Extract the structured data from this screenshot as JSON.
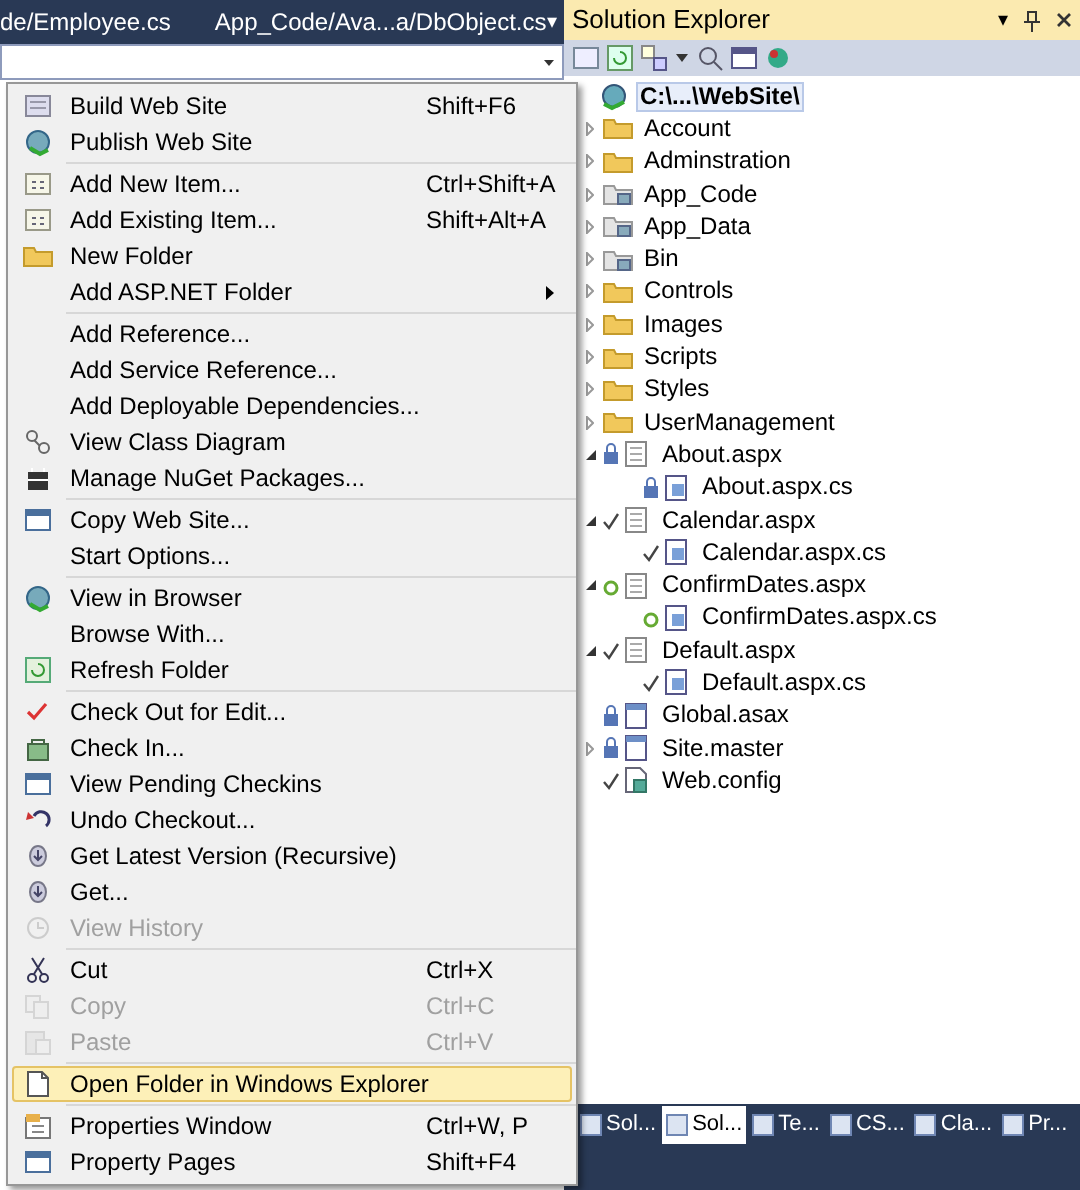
{
  "document_tabs": [
    {
      "label": "de/Employee.cs"
    },
    {
      "label": "App_Code/Ava...a/DbObject.cs"
    }
  ],
  "tabs_menu_button": "▾",
  "context_menu": [
    {
      "label": "Build Web Site",
      "shortcut": "Shift+F6",
      "disabled": false,
      "selected": false
    },
    {
      "label": "Publish Web Site",
      "disabled": false,
      "selected": false,
      "separator_after": true
    },
    {
      "label": "Add New Item...",
      "shortcut": "Ctrl+Shift+A",
      "disabled": false,
      "selected": false
    },
    {
      "label": "Add Existing Item...",
      "shortcut": "Shift+Alt+A",
      "disabled": false,
      "selected": false
    },
    {
      "label": "New Folder",
      "disabled": false,
      "selected": false
    },
    {
      "label": "Add ASP.NET Folder",
      "submenu": true,
      "disabled": false,
      "selected": false,
      "separator_after": true
    },
    {
      "label": "Add Reference...",
      "disabled": false,
      "selected": false
    },
    {
      "label": "Add Service Reference...",
      "disabled": false,
      "selected": false
    },
    {
      "label": "Add Deployable Dependencies...",
      "disabled": false,
      "selected": false
    },
    {
      "label": "View Class Diagram",
      "disabled": false,
      "selected": false
    },
    {
      "label": "Manage NuGet Packages...",
      "disabled": false,
      "selected": false,
      "separator_after": true
    },
    {
      "label": "Copy Web Site...",
      "disabled": false,
      "selected": false
    },
    {
      "label": "Start Options...",
      "disabled": false,
      "selected": false,
      "separator_after": true
    },
    {
      "label": "View in Browser",
      "disabled": false,
      "selected": false
    },
    {
      "label": "Browse With...",
      "disabled": false,
      "selected": false
    },
    {
      "label": "Refresh Folder",
      "disabled": false,
      "selected": false,
      "separator_after": true
    },
    {
      "label": "Check Out for Edit...",
      "disabled": false,
      "selected": false
    },
    {
      "label": "Check In...",
      "disabled": false,
      "selected": false
    },
    {
      "label": "View Pending Checkins",
      "disabled": false,
      "selected": false
    },
    {
      "label": "Undo Checkout...",
      "disabled": false,
      "selected": false
    },
    {
      "label": "Get Latest Version (Recursive)",
      "disabled": false,
      "selected": false
    },
    {
      "label": "Get...",
      "disabled": false,
      "selected": false
    },
    {
      "label": "View History",
      "disabled": true,
      "selected": false,
      "separator_after": true
    },
    {
      "label": "Cut",
      "shortcut": "Ctrl+X",
      "disabled": false,
      "selected": false
    },
    {
      "label": "Copy",
      "shortcut": "Ctrl+C",
      "disabled": true,
      "selected": false
    },
    {
      "label": "Paste",
      "shortcut": "Ctrl+V",
      "disabled": true,
      "selected": false,
      "separator_after": true
    },
    {
      "label": "Open Folder in Windows Explorer",
      "disabled": false,
      "selected": true,
      "separator_after": true
    },
    {
      "label": "Properties Window",
      "shortcut": "Ctrl+W, P",
      "disabled": false,
      "selected": false
    },
    {
      "label": "Property Pages",
      "shortcut": "Shift+F4",
      "disabled": false,
      "selected": false
    }
  ],
  "solution_explorer": {
    "title": "Solution Explorer",
    "window_controls": [
      "▾"
    ],
    "tree": [
      {
        "label": "C:\\...\\WebSite\\",
        "kind": "site",
        "selected": true,
        "children": [
          {
            "label": "Account",
            "kind": "folder",
            "selected": false,
            "expanded": false
          },
          {
            "label": "Adminstration",
            "kind": "folder",
            "selected": false,
            "expanded": false
          },
          {
            "label": "App_Code",
            "kind": "special_folder",
            "selected": false,
            "expanded": false
          },
          {
            "label": "App_Data",
            "kind": "special_folder",
            "selected": false,
            "expanded": false
          },
          {
            "label": "Bin",
            "kind": "special_folder",
            "selected": false,
            "expanded": false
          },
          {
            "label": "Controls",
            "kind": "folder",
            "selected": false,
            "expanded": false
          },
          {
            "label": "Images",
            "kind": "folder",
            "selected": false,
            "expanded": false
          },
          {
            "label": "Scripts",
            "kind": "folder",
            "selected": false,
            "expanded": false
          },
          {
            "label": "Styles",
            "kind": "folder",
            "selected": false,
            "expanded": false
          },
          {
            "label": "UserManagement",
            "kind": "folder",
            "selected": false,
            "expanded": false
          },
          {
            "label": "About.aspx",
            "kind": "page",
            "checked_out": false,
            "pending_add": false,
            "selected": false,
            "expanded": true,
            "children": [
              {
                "label": "About.aspx.cs",
                "kind": "code",
                "checked_out": false,
                "pending_add": false,
                "selected": false
              }
            ]
          },
          {
            "label": "Calendar.aspx",
            "kind": "page",
            "checked_out": true,
            "pending_add": false,
            "selected": false,
            "expanded": true,
            "children": [
              {
                "label": "Calendar.aspx.cs",
                "kind": "code",
                "checked_out": true,
                "pending_add": false,
                "selected": false
              }
            ]
          },
          {
            "label": "ConfirmDates.aspx",
            "kind": "page",
            "checked_out": false,
            "pending_add": true,
            "selected": false,
            "expanded": true,
            "children": [
              {
                "label": "ConfirmDates.aspx.cs",
                "kind": "code",
                "checked_out": false,
                "pending_add": true,
                "selected": false
              }
            ]
          },
          {
            "label": "Default.aspx",
            "kind": "page",
            "checked_out": true,
            "pending_add": false,
            "selected": false,
            "expanded": true,
            "children": [
              {
                "label": "Default.aspx.cs",
                "kind": "code",
                "checked_out": true,
                "pending_add": false,
                "selected": false
              }
            ]
          },
          {
            "label": "Global.asax",
            "kind": "file",
            "checked_out": false,
            "pending_add": false,
            "selected": false
          },
          {
            "label": "Site.master",
            "kind": "file",
            "checked_out": false,
            "pending_add": false,
            "selected": false,
            "expanded": false
          },
          {
            "label": "Web.config",
            "kind": "config",
            "checked_out": true,
            "pending_add": false,
            "selected": false
          }
        ]
      }
    ]
  },
  "bottom_tabs": [
    {
      "label": "Sol...",
      "selected": false
    },
    {
      "label": "Sol...",
      "selected": true
    },
    {
      "label": "Te...",
      "selected": false
    },
    {
      "label": "CS...",
      "selected": false
    },
    {
      "label": "Cla...",
      "selected": false
    },
    {
      "label": "Pr...",
      "selected": false
    }
  ]
}
